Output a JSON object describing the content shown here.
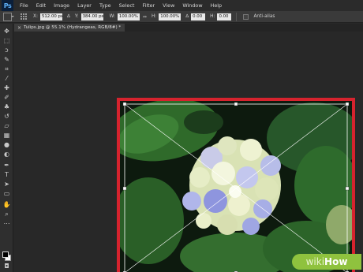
{
  "app": {
    "logo": "Ps"
  },
  "menu": [
    "File",
    "Edit",
    "Image",
    "Layer",
    "Type",
    "Select",
    "Filter",
    "View",
    "Window",
    "Help"
  ],
  "options": {
    "x_label": "X:",
    "x_value": "512.00 px",
    "y_label": "Y:",
    "y_value": "384.00 px",
    "w_label": "W:",
    "w_value": "100.00%",
    "link_glyph": "⇔",
    "h_label": "H:",
    "h_value": "100.00%",
    "angle_label": "∆",
    "angle_value": "0.00",
    "h2_label": "H:",
    "h2_value": "0.00",
    "antialias_label": "Anti-alias"
  },
  "document": {
    "tab_close": "×",
    "tab_title": "Tulips.jpg @ 55.1% (Hydrangeas, RGB/8#) *"
  },
  "tools": [
    "move-tool",
    "marquee-tool",
    "lasso-tool",
    "quick-select-tool",
    "crop-tool",
    "eyedropper-tool",
    "healing-tool",
    "brush-tool",
    "clone-stamp-tool",
    "history-brush-tool",
    "eraser-tool",
    "gradient-tool",
    "blur-tool",
    "dodge-tool",
    "pen-tool",
    "type-tool",
    "path-select-tool",
    "shape-tool",
    "hand-tool",
    "zoom-tool"
  ],
  "colors": {
    "highlight": "#d6232e",
    "ps_blue": "#5fb0f6",
    "wikihow_green": "#8fc23e"
  },
  "watermark": {
    "wiki": "wiki",
    "how": "How"
  }
}
